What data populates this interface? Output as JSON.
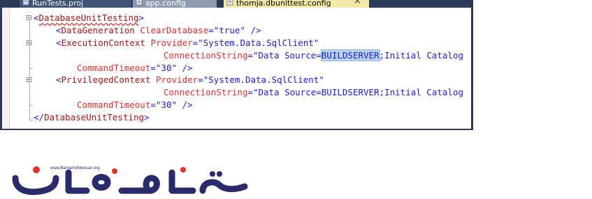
{
  "tabs": [
    {
      "label": "RunTests.proj",
      "icon": "project-file-icon"
    },
    {
      "label": "app.config",
      "icon": "config-file-icon"
    },
    {
      "label": "thomja.dbunittest.config",
      "icon": "config-file-icon",
      "close": "×"
    }
  ],
  "code": {
    "l1": {
      "lt": "<",
      "tag": "DatabaseUnitTesting",
      "gt": ">"
    },
    "l2": {
      "lt": "<",
      "tag": "DataGeneration",
      "attr": "ClearDatabase",
      "eq": "=",
      "val": "\"true\"",
      "end": " />"
    },
    "l3": {
      "lt": "<",
      "tag": "ExecutionContext",
      "attr": "Provider",
      "eq": "=",
      "val": "\"System.Data.SqlClient\""
    },
    "l4": {
      "attr": "ConnectionString",
      "eq": "=",
      "val_pre": "\"Data Source=",
      "val_hl": "BUILDSERVER",
      "val_post": ";Initial Catalog"
    },
    "l5": {
      "attr": "CommandTimeout",
      "eq": "=",
      "val": "\"30\"",
      "end": " />"
    },
    "l6": {
      "lt": "<",
      "tag": "PrivilegedContext",
      "attr": "Provider",
      "eq": "=",
      "val": "\"System.Data.SqlClient\""
    },
    "l7": {
      "attr": "ConnectionString",
      "eq": "=",
      "val": "\"Data Source=BUILDSERVER;Initial Catalog"
    },
    "l8": {
      "attr": "CommandTimeout",
      "eq": "=",
      "val": "\"30\"",
      "end": " />"
    },
    "l9": {
      "lt": "</",
      "tag": "DatabaseUnitTesting",
      "gt": ">"
    }
  },
  "logo": {
    "url": "www.BarnameNevisan.org",
    "text": "برنامه نویسان",
    "color": "#2b2b6b",
    "accent": "#e0312a"
  }
}
